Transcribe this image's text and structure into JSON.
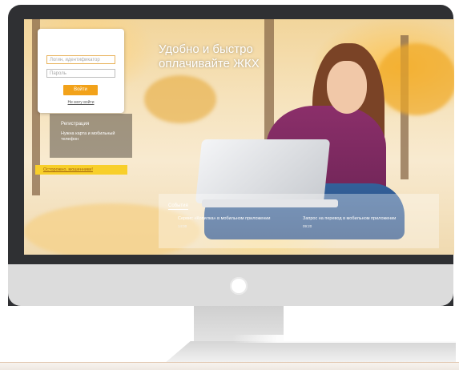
{
  "screen": {
    "headline": "Удобно и быстро оплачивайте ЖКХ",
    "login": {
      "login_placeholder": "Логин, идентификатор",
      "password_placeholder": "Пароль",
      "submit_label": "Войти",
      "forgot_link": "Не могу войти"
    },
    "registration": {
      "title": "Регистрация",
      "text": "Нужна карта и мобильный телефон"
    },
    "warning": "Осторожно, мошенники!",
    "events": {
      "title": "События",
      "items": [
        {
          "text": "Сервис «Копилка» в мобильном приложении",
          "time": "14:00"
        },
        {
          "text": "Запрос на перевод в мобильном приложении",
          "time": "09:20"
        }
      ]
    }
  },
  "colors": {
    "accent": "#f2a21a",
    "warning": "#f8cf2a",
    "monitor_bezel": "#2f3033",
    "monitor_chin": "#dcdcdc"
  }
}
